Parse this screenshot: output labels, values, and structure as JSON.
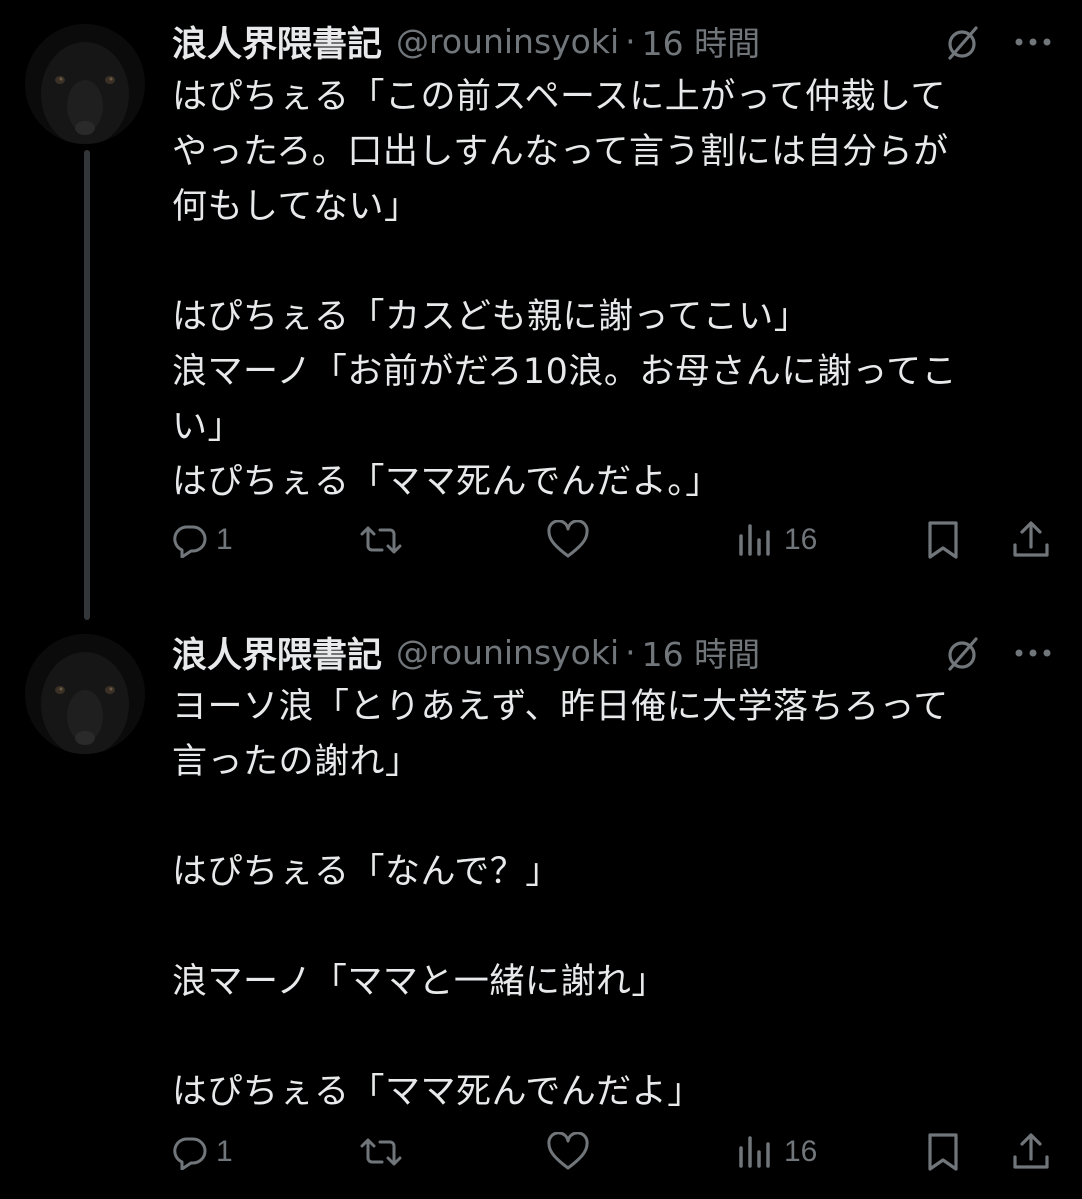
{
  "tweets": [
    {
      "display_name": "浪人界隈書記",
      "handle": "@rouninsyoki",
      "separator": "·",
      "time": "16 時間",
      "text": "はぴちぇる「この前スペースに上がって仲裁して\nやったろ。口出しすんなって言う割には自分らが\n何もしてない」\n\nはぴちぇる「カスども親に謝ってこい」\n浪マーノ「お前がだろ10浪。お母さんに謝ってこ\nい」\nはぴちぇる「ママ死んでんだよ。」",
      "reply_count": "1",
      "view_count": "16"
    },
    {
      "display_name": "浪人界隈書記",
      "handle": "@rouninsyoki",
      "separator": "·",
      "time": "16 時間",
      "text": "ヨーソ浪「とりあえず、昨日俺に大学落ちろって\n言ったの謝れ」\n\nはぴちぇる「なんで？」\n\n浪マーノ「ママと一緒に謝れ」\n\nはぴちぇる「ママ死んでんだよ」",
      "reply_count": "1",
      "view_count": "16"
    }
  ],
  "icons": {
    "grok": "grok-icon",
    "more": "more-icon",
    "reply": "reply-icon",
    "retweet": "retweet-icon",
    "like": "like-icon",
    "views": "views-icon",
    "bookmark": "bookmark-icon",
    "share": "share-icon"
  },
  "colors": {
    "background": "#000000",
    "primary_text": "#e7e9ea",
    "secondary_text": "#71767b",
    "thread_line": "#333639"
  }
}
